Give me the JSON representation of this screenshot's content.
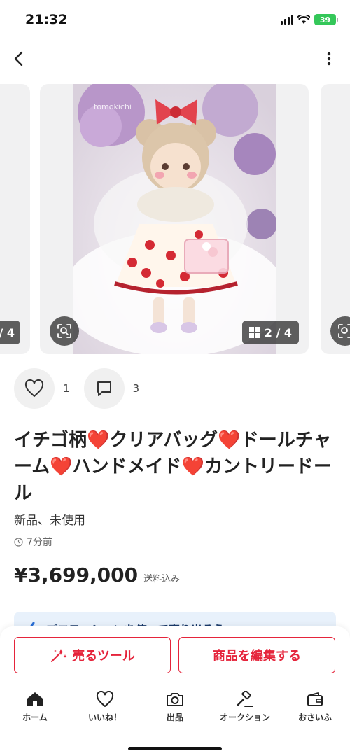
{
  "status_bar": {
    "time": "21:32",
    "battery": "39"
  },
  "carousel": {
    "left_counter": "/ 4",
    "main_counter": "2 / 4",
    "watermark": "tomokichi"
  },
  "engagement": {
    "likes": "1",
    "comments": "3"
  },
  "item": {
    "title_parts": [
      "イチゴ柄",
      "❤️",
      "クリアバッグ",
      "❤️",
      "ドールチャーム",
      "❤️",
      "ハンドメイド",
      "❤️",
      "カントリードール"
    ],
    "condition": "新品、未使用",
    "posted": "7分前",
    "price": "¥3,699,000",
    "shipping": "送料込み"
  },
  "promo": {
    "text": "プロモーションを使って売り出そう"
  },
  "actions": {
    "sell_tool": "売るツール",
    "edit_item": "商品を編集する"
  },
  "tabbar": [
    {
      "label": "ホーム",
      "icon": "home-icon"
    },
    {
      "label": "いいね！",
      "icon": "heart-icon"
    },
    {
      "label": "出品",
      "icon": "camera-icon"
    },
    {
      "label": "オークション",
      "icon": "gavel-icon"
    },
    {
      "label": "おさいふ",
      "icon": "wallet-icon"
    }
  ],
  "colors": {
    "accent": "#e5243b",
    "battery": "#34c759"
  }
}
